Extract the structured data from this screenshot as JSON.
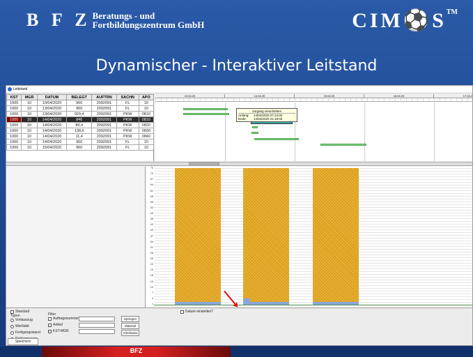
{
  "header": {
    "logo_letters": "B F Z",
    "logo_line1": "Beratungs - und",
    "logo_line2": "Fortbildungszentrum GmbH",
    "product": "CIM⚽S",
    "product_tm": "TM",
    "title": "Dynamischer - Interaktiver Leitstand"
  },
  "window": {
    "title": "Leitstand"
  },
  "orders": {
    "columns": [
      "KST",
      "MGR",
      "DATUM",
      "BELEGT",
      "AUFTRN",
      "SACHN",
      "APO"
    ],
    "rows": [
      [
        "1000",
        "10",
        "10/04/2020",
        "960",
        "2092091",
        "FL",
        "10"
      ],
      [
        "1000",
        "10",
        "13/04/2020",
        "960",
        "2092091",
        "FL",
        "10"
      ],
      [
        "1000",
        "10",
        "13/04/2020",
        "929,4",
        "2092091",
        "PKW",
        "0810"
      ],
      [
        "1000",
        "10",
        "14/04/2020",
        "846",
        "2092091",
        "PKW",
        "0810"
      ],
      [
        "1000",
        "10",
        "14/04/2020",
        "89,4",
        "2092091",
        "PKW",
        "0820"
      ],
      [
        "1000",
        "10",
        "14/04/2020",
        "138,6",
        "2092091",
        "PKW",
        "0830"
      ],
      [
        "1000",
        "10",
        "14/04/2020",
        "11,4",
        "2092091",
        "PKW",
        "0840"
      ],
      [
        "1000",
        "10",
        "14/04/2020",
        "960",
        "2092091",
        "FL",
        "10"
      ],
      [
        "1000",
        "10",
        "15/04/2020",
        "960",
        "2092091",
        "FL",
        "10"
      ]
    ],
    "selected_index": 3
  },
  "gantt": {
    "days": [
      "13.04.20",
      "14.04.20",
      "15.04.20",
      "16.04.20",
      "17.04.20"
    ],
    "tooltip": {
      "heading": "Vorgang verschieben",
      "start_label": "Anfang:",
      "start_value": "14/04/2020 07:13:00",
      "end_label": "Ende:",
      "end_value": "14/04/2020 21:19:00"
    }
  },
  "capacity": {
    "y_ticks": [
      "73",
      "70",
      "67",
      "64",
      "61",
      "58",
      "55",
      "52",
      "49",
      "46",
      "43",
      "40",
      "37",
      "34",
      "31",
      "28",
      "25",
      "22",
      "19",
      "16",
      "13",
      "10",
      "7",
      "4",
      "1"
    ]
  },
  "controls": {
    "standard": "Standard",
    "type_label": "Typen",
    "radio_options": [
      "Vorlauszug",
      "Wertlubit",
      "Fertigungsstand",
      "Prüfanmerung"
    ],
    "filter_label": "Filter",
    "filter_options": [
      "Auftragsnummer",
      "Artikel",
      "KST-MGR"
    ],
    "buttons": [
      "Springen",
      "Material",
      "Arbeitsans"
    ],
    "date_check": "Datum einstellen?",
    "save_tab": "Speichern"
  },
  "footer": {
    "brand": "BFZ"
  },
  "colors": {
    "background": "#1f4a94",
    "load_block": "#e5a51a",
    "bar": "#7ecf7e",
    "selected_row": "#2a2a2a"
  }
}
